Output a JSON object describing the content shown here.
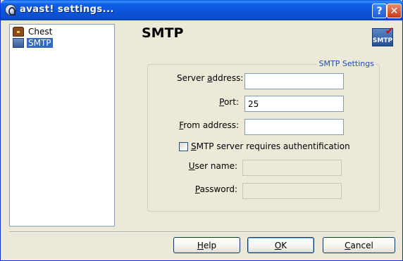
{
  "window": {
    "title": "avast! settings..."
  },
  "titlebar": {
    "help_glyph": "?",
    "close_glyph": "✕"
  },
  "tree": {
    "items": [
      {
        "label": "Chest",
        "icon": "chest-icon",
        "selected": false
      },
      {
        "label": "SMTP",
        "icon": "smtp-icon",
        "selected": true
      }
    ]
  },
  "page": {
    "title": "SMTP",
    "header_icon_text": "SMTP",
    "header_icon_check": "✔"
  },
  "group": {
    "label": "SMTP Settings",
    "server_address": {
      "label_pre": "Server ",
      "label_acc": "a",
      "label_post": "ddress:",
      "value": ""
    },
    "port": {
      "label_pre": "",
      "label_acc": "P",
      "label_post": "ort:",
      "value": "25"
    },
    "from_address": {
      "label_pre": "",
      "label_acc": "F",
      "label_post": "rom address:",
      "value": ""
    },
    "auth_checkbox": {
      "label_pre": "",
      "label_acc": "S",
      "label_post": "MTP server requires authentification",
      "checked": false
    },
    "user_name": {
      "label_pre": "",
      "label_acc": "U",
      "label_post": "ser name:",
      "value": ""
    },
    "password": {
      "label_pre": "",
      "label_acc": "P",
      "label_post": "assword:",
      "value": ""
    }
  },
  "buttons": {
    "help": {
      "label_pre": "",
      "label_acc": "H",
      "label_post": "elp"
    },
    "ok": {
      "label_pre": "",
      "label_acc": "O",
      "label_post": "K"
    },
    "cancel": {
      "label_pre": "",
      "label_acc": "C",
      "label_post": "ancel"
    }
  },
  "colors": {
    "title_bar": "#0a5de0",
    "selection": "#316ac5",
    "group_label": "#1c4cb4"
  }
}
